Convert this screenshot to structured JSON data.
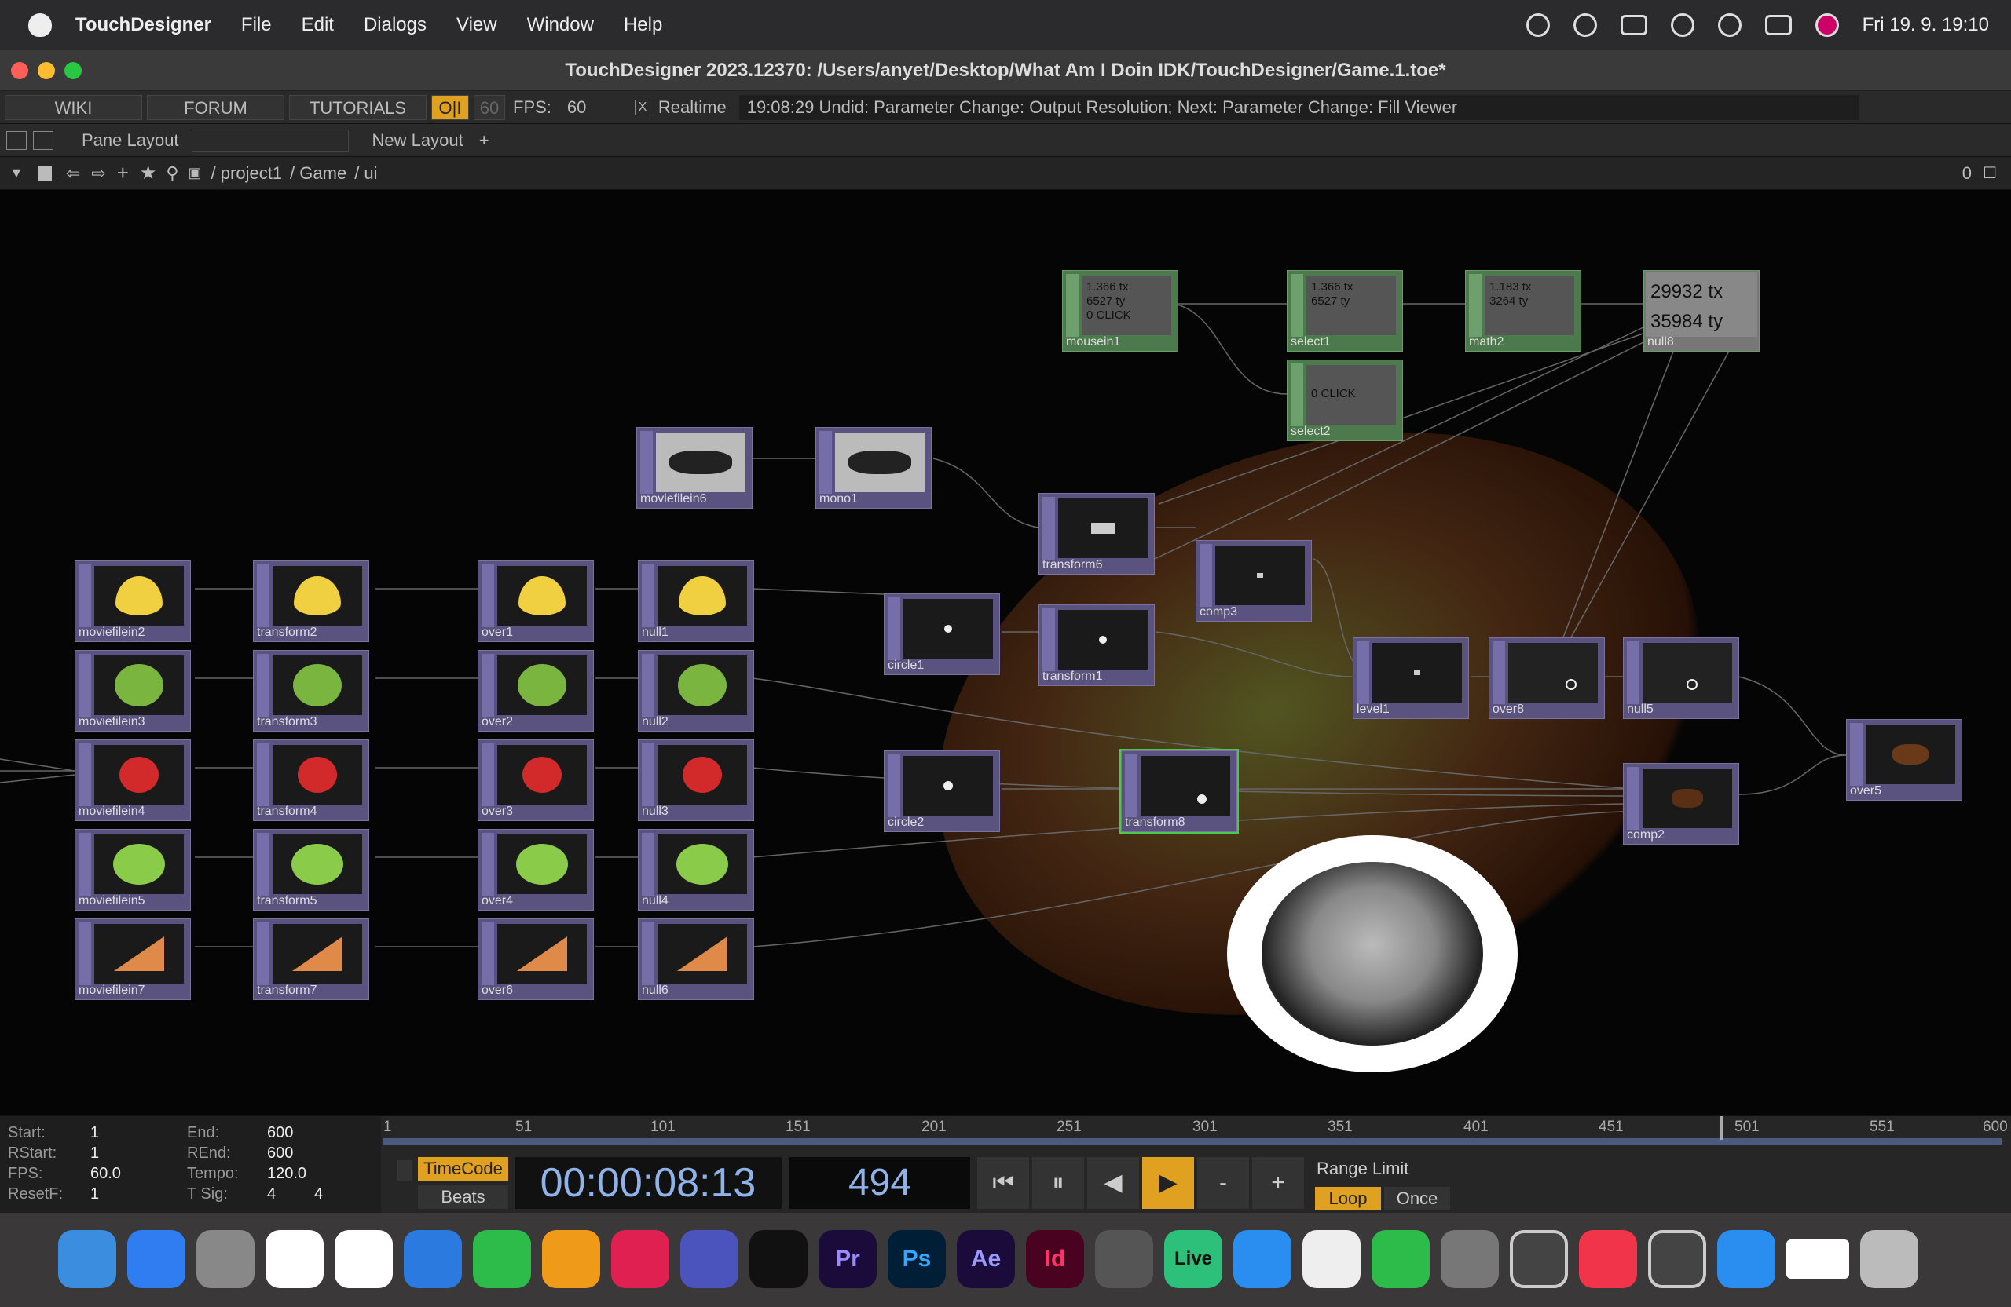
{
  "menubar": {
    "app": "TouchDesigner",
    "items": [
      "File",
      "Edit",
      "Dialogs",
      "View",
      "Window",
      "Help"
    ],
    "clock": "Fri 19. 9.  19:10"
  },
  "window": {
    "title": "TouchDesigner 2023.12370: /Users/anyet/Desktop/What Am I Doin IDK/TouchDesigner/Game.1.toe*"
  },
  "toolbar": {
    "wiki": "WIKI",
    "forum": "FORUM",
    "tutorials": "TUTORIALS",
    "oi": "O|I",
    "fps_cap": "60",
    "fps_label": "FPS:",
    "fps_value": "60",
    "realtime_check": "X",
    "realtime": "Realtime",
    "status": "19:08:29 Undid: Parameter Change: Output Resolution; Next: Parameter Change: Fill Viewer"
  },
  "layout": {
    "pane_layout": "Pane Layout",
    "new_layout": "New Layout",
    "plus": "+"
  },
  "path": {
    "crumbs": [
      "/ project1",
      "/ Game",
      "/ ui"
    ],
    "zero": "0"
  },
  "nodes": {
    "mousein1": {
      "label": "mousein1",
      "values": [
        "1.366 tx",
        "6527 ty",
        "0 CLICK"
      ]
    },
    "select1": {
      "label": "select1",
      "values": [
        "1.366 tx",
        "6527 ty"
      ]
    },
    "math2": {
      "label": "math2",
      "values": [
        "1.183 tx",
        "3264 ty"
      ]
    },
    "null8": {
      "label": "null8",
      "values": [
        "29932 tx",
        "35984 ty"
      ]
    },
    "select2": {
      "label": "select2",
      "values": [
        "0 CLICK"
      ]
    },
    "moviefilein6": {
      "label": "moviefilein6"
    },
    "mono1": {
      "label": "mono1"
    },
    "transform6": {
      "label": "transform6"
    },
    "comp3": {
      "label": "comp3"
    },
    "moviefilein2": {
      "label": "moviefilein2"
    },
    "transform2": {
      "label": "transform2"
    },
    "over1": {
      "label": "over1"
    },
    "null1": {
      "label": "null1"
    },
    "circle1": {
      "label": "circle1"
    },
    "transform1": {
      "label": "transform1"
    },
    "level1": {
      "label": "level1"
    },
    "over8": {
      "label": "over8"
    },
    "null5": {
      "label": "null5"
    },
    "over5": {
      "label": "over5"
    },
    "comp2": {
      "label": "comp2"
    },
    "moviefilein3": {
      "label": "moviefilein3"
    },
    "transform3": {
      "label": "transform3"
    },
    "over2": {
      "label": "over2"
    },
    "null2": {
      "label": "null2"
    },
    "moviefilein4": {
      "label": "moviefilein4"
    },
    "transform4": {
      "label": "transform4"
    },
    "over3": {
      "label": "over3"
    },
    "null3": {
      "label": "null3"
    },
    "circle2": {
      "label": "circle2"
    },
    "transform8": {
      "label": "transform8"
    },
    "moviefilein5": {
      "label": "moviefilein5"
    },
    "transform5": {
      "label": "transform5"
    },
    "over4": {
      "label": "over4"
    },
    "null4": {
      "label": "null4"
    },
    "moviefilein7": {
      "label": "moviefilein7"
    },
    "transform7": {
      "label": "transform7"
    },
    "over6": {
      "label": "over6"
    },
    "null6": {
      "label": "null6"
    }
  },
  "timeline": {
    "start_k": "Start:",
    "start": "1",
    "rstart_k": "RStart:",
    "rstart": "1",
    "fps_k": "FPS:",
    "fps": "60.0",
    "resetf_k": "ResetF:",
    "resetf": "1",
    "end_k": "End:",
    "end": "600",
    "rend_k": "REnd:",
    "rend": "600",
    "tempo_k": "Tempo:",
    "tempo": "120.0",
    "tsig_k": "T Sig:",
    "tsig_a": "4",
    "tsig_b": "4",
    "ruler": [
      "1",
      "51",
      "101",
      "151",
      "201",
      "251",
      "301",
      "351",
      "401",
      "451",
      "501",
      "551",
      "600"
    ],
    "timecode_label": "TimeCode",
    "beats_label": "Beats",
    "timecode": "00:00:08:13",
    "frame": "494",
    "range_limit": "Range Limit",
    "loop": "Loop",
    "once": "Once",
    "minus": "-",
    "plus": "+"
  },
  "dock": {
    "apps": [
      "Finder",
      "App Store",
      "Launchpad",
      "Freeform",
      "Reminders",
      "Keynote",
      "Numbers",
      "Pages",
      "Creative Cloud",
      "Teams",
      "Vectorworks",
      "Pr",
      "Ps",
      "Ae",
      "Id",
      "GarageBand",
      "Live",
      "Safari",
      "Photos",
      "FaceTime",
      "System Settings",
      "TouchDesigner",
      "Music",
      "TouchDesigner",
      "Safari",
      "Window",
      "Trash"
    ]
  },
  "colors": {
    "top_node": "#5a5380",
    "chop_node": "#4c7a4c",
    "timecode": "#8fb3e8",
    "active_orange": "#e0a020"
  }
}
